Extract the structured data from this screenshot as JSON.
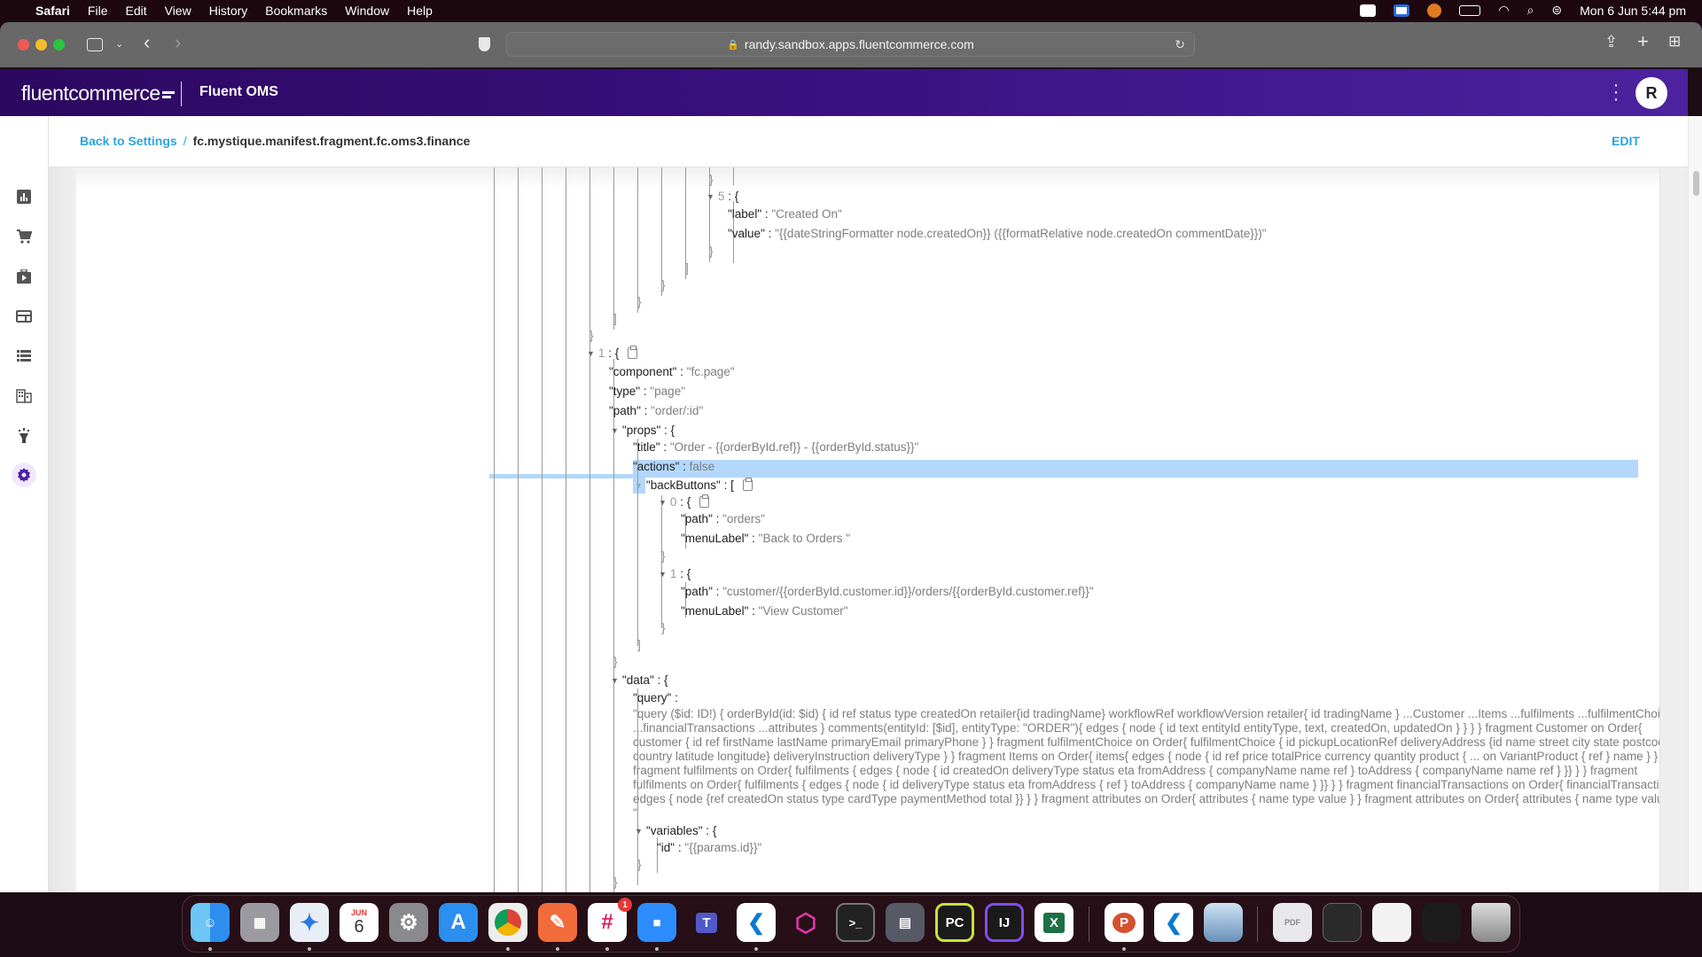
{
  "menubar": {
    "app": "Safari",
    "items": [
      "File",
      "Edit",
      "View",
      "History",
      "Bookmarks",
      "Window",
      "Help"
    ],
    "datetime": "Mon 6 Jun  5:44 pm",
    "tray_icons": [
      "zoom-icon",
      "app-icon",
      "vpn-icon",
      "battery-icon",
      "wifi-icon",
      "spotlight-icon",
      "control-center-icon"
    ]
  },
  "browser": {
    "url": "randy.sandbox.apps.fluentcommerce.com"
  },
  "app": {
    "brand_light": "fluent",
    "brand_rest": "commerce",
    "product": "Fluent OMS",
    "avatar_initial": "R",
    "accent": "#2ba4dd",
    "header_color": "#3b1180"
  },
  "subheader": {
    "back_link": "Back to Settings",
    "separator": "/",
    "current": "fc.mystique.manifest.fragment.fc.oms3.finance",
    "edit_label": "EDIT"
  },
  "nav": [
    "analytics-icon",
    "cart-icon",
    "briefcase-icon",
    "window-icon",
    "list-icon",
    "building-icon",
    "lamp-icon",
    "settings-icon"
  ],
  "json_view": {
    "item5": {
      "index": "5",
      "label_key": "\"label\"",
      "label_val": "\"Created On\"",
      "value_key": "\"value\"",
      "value_val": "\"{{dateStringFormatter node.createdOn}} ({{formatRelative node.createdOn commentDate}})\""
    },
    "page1": {
      "index": "1",
      "component_key": "\"component\"",
      "component_val": "\"fc.page\"",
      "type_key": "\"type\"",
      "type_val": "\"page\"",
      "path_key": "\"path\"",
      "path_val": "\"order/:id\"",
      "props_key": "\"props\"",
      "title_key": "\"title\"",
      "title_val": "\"Order - {{orderById.ref}} - {{orderById.status}}\"",
      "actions_key": "\"actions\"",
      "actions_val": "false",
      "backButtons_key": "\"backButtons\"",
      "bb0_index": "0",
      "bb0_path_key": "\"path\"",
      "bb0_path_val": "\"orders\"",
      "bb0_label_key": "\"menuLabel\"",
      "bb0_label_val": "\"Back to Orders \"",
      "bb1_index": "1",
      "bb1_path_key": "\"path\"",
      "bb1_path_val": "\"customer/{{orderById.customer.id}}/orders/{{orderById.customer.ref}}\"",
      "bb1_label_key": "\"menuLabel\"",
      "bb1_label_val": "\"View Customer\"",
      "data_key": "\"data\"",
      "query_key": "\"query\"",
      "query_val": "\"query ($id: ID!) { orderById(id: $id) { id ref status type createdOn retailer{id tradingName} workflowRef workflowVersion retailer{ id tradingName } ...Customer ...Items ...fulfilments ...fulfilmentChoice ...financialTransactions ...attributes } comments(entityId: [$id], entityType: \"ORDER\"){ edges { node { id text entityId entityType, text, createdOn, updatedOn } } } } fragment Customer on Order{ customer { id ref firstName lastName primaryEmail primaryPhone } } fragment fulfilmentChoice on Order{ fulfilmentChoice { id pickupLocationRef deliveryAddress {id name street city state postcode country latitude longitude} deliveryInstruction deliveryType } } fragment Items on Order{ items{ edges { node { id ref price totalPrice currency quantity product { ... on VariantProduct { ref } name } } } } } fragment fulfilments on Order{ fulfilments { edges { node { id createdOn deliveryType status eta fromAddress { companyName name ref } toAddress { companyName name ref } }} } } fragment fulfilments on Order{ fulfilments { edges { node { id deliveryType status eta fromAddress { ref } toAddress { companyName name } }} } } fragment financialTransactions on Order{ financialTransactions { edges { node {ref createdOn status type cardType paymentMethod total }} } } fragment attributes on Order{ attributes { name type value } } fragment attributes on Order{ attributes { name type value } } \"",
      "variables_key": "\"variables\"",
      "id_key": "\"id\"",
      "id_val": "\"{{params.id}}\""
    },
    "punct": {
      "colon": " : ",
      "open_obj": "{",
      "close_obj": "}",
      "open_arr": "[",
      "close_arr": "]",
      "triangle": "▼"
    }
  },
  "dock": {
    "apps": [
      "Finder",
      "Launchpad",
      "Safari",
      "Calendar",
      "System Preferences",
      "App Store",
      "Chrome",
      "Postman",
      "Slack",
      "Zoom",
      "Teams",
      "VS Code",
      "GraphQL",
      "Terminal",
      "Network Utility",
      "PyCharm",
      "IntelliJ IDEA",
      "Excel",
      "PowerPoint",
      "VS Code",
      "Preview",
      "Documents",
      "Window 1",
      "Window 2",
      "Window 3",
      "Trash"
    ],
    "calendar_month": "JUN",
    "calendar_day": "6",
    "slack_badge": "1",
    "pycharm_label": "PC",
    "intellij_label": "IJ",
    "excel_label": "X",
    "ppt_label": "P",
    "teams_label": "T"
  }
}
